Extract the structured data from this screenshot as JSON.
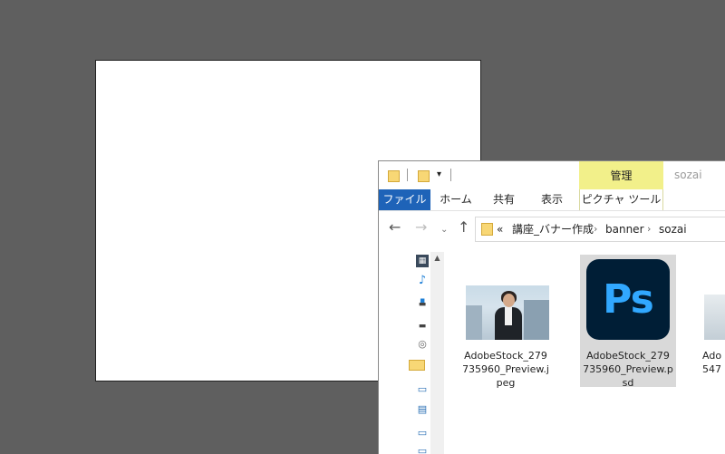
{
  "explorer": {
    "window_title": "sozai",
    "manage_tab": "管理",
    "quick_access_dropdown": "▾",
    "ribbon_tabs": [
      "ファイル",
      "ホーム",
      "共有",
      "表示"
    ],
    "picture_tools_tab": "ピクチャ ツール",
    "address": {
      "overflow": "«",
      "crumbs": [
        "講座_バナー作成",
        "banner",
        "sozai"
      ],
      "separator": "›"
    },
    "nav_buttons": {
      "back": "←",
      "forward": "→",
      "recent": "⌄",
      "up": "↑"
    },
    "files": [
      {
        "name": "AdobeStock_279735960_Preview.jpeg",
        "lines": [
          "AdobeStock_279",
          "735960_Preview.j",
          "peg"
        ],
        "icon": "jpeg-thumbnail",
        "selected": false
      },
      {
        "name": "AdobeStock_279735960_Preview.psd",
        "lines": [
          "AdobeStock_279",
          "735960_Preview.p",
          "sd"
        ],
        "icon": "photoshop-icon",
        "icon_text": "Ps",
        "selected": true
      },
      {
        "name": "Ado…547…",
        "lines": [
          "Ado",
          "547"
        ],
        "icon": "image-thumbnail",
        "selected": false
      }
    ]
  },
  "colors": {
    "desktop_bg": "#5f5f5f",
    "file_tab_blue": "#1e63b8",
    "manage_yellow": "#f2f08a",
    "ps_bg": "#001e36",
    "ps_text": "#31a8ff",
    "selection": "#d9d9d9"
  }
}
